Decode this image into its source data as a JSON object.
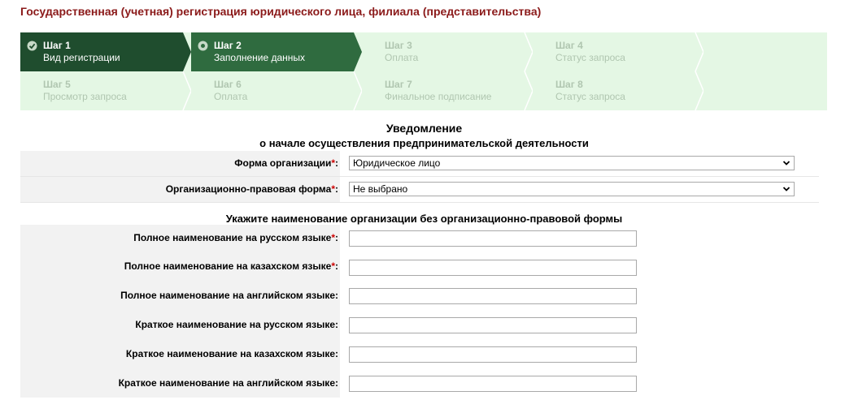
{
  "page_title": "Государственная (учетная) регистрация юридического лица, филиала (представительства)",
  "wizard": {
    "steps": [
      {
        "num": "Шаг 1",
        "label": "Вид регистрации",
        "state": "done"
      },
      {
        "num": "Шаг 2",
        "label": "Заполнение данных",
        "state": "active"
      },
      {
        "num": "Шаг 3",
        "label": "Оплата",
        "state": "todo"
      },
      {
        "num": "Шаг 4",
        "label": "Статус запроса",
        "state": "todo"
      },
      {
        "num": "Шаг 5",
        "label": "Просмотр запроса",
        "state": "todo"
      },
      {
        "num": "Шаг 6",
        "label": "Оплата",
        "state": "todo"
      },
      {
        "num": "Шаг 7",
        "label": "Финальное подписание",
        "state": "todo"
      },
      {
        "num": "Шаг 8",
        "label": "Статус запроса",
        "state": "todo"
      }
    ],
    "colors": {
      "done": "#1f4d2e",
      "active": "#2f6b3f",
      "todo_bg": "#e4f7e4",
      "todo_text": "#b0c6b0"
    }
  },
  "notice": {
    "title": "Уведомление",
    "subtitle": "о начале осуществления предпринимательской деятельности"
  },
  "org_form": {
    "label": "Форма организации:",
    "required_mark": "*",
    "value": "Юридическое лицо"
  },
  "legal_form": {
    "label": "Организационно-правовая форма:",
    "required_mark": "*",
    "value": "Не выбрано"
  },
  "names_section": {
    "title": "Укажите наименование организации без организационно-правовой формы",
    "fields": [
      {
        "label": "Полное наименование на русском языке:",
        "required_mark": "*",
        "value": ""
      },
      {
        "label": "Полное наименование на казахском языке:",
        "required_mark": "*",
        "value": ""
      },
      {
        "label": "Полное наименование на английском языке:",
        "required_mark": "",
        "value": ""
      },
      {
        "label": "Краткое наименование на русском языке:",
        "required_mark": "",
        "value": ""
      },
      {
        "label": "Краткое наименование на казахском языке:",
        "required_mark": "",
        "value": ""
      },
      {
        "label": "Краткое наименование на английском языке:",
        "required_mark": "",
        "value": ""
      }
    ]
  },
  "accent_color": "#8b1a1a"
}
